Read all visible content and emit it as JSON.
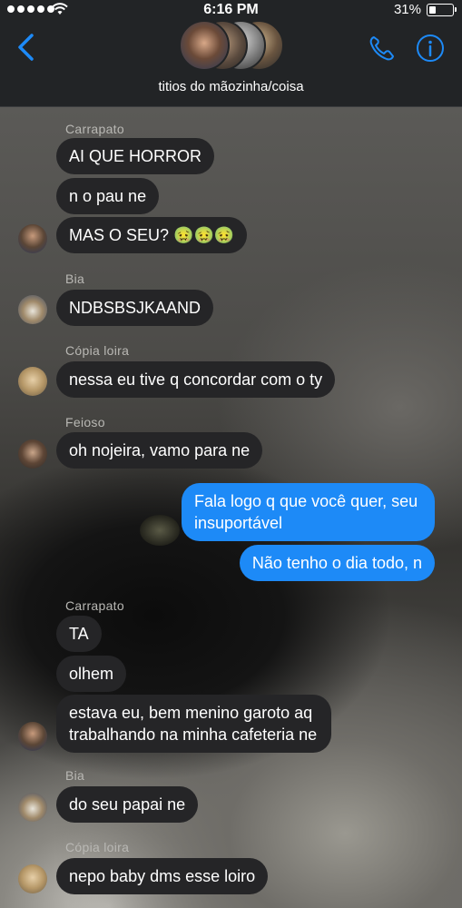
{
  "status_bar": {
    "time": "6:16 PM",
    "battery": "31%",
    "battery_level": 0.31,
    "signal_dots": 5
  },
  "header": {
    "group_name": "titios do mãozinha/coisa",
    "accent_color": "#1d8af7"
  },
  "messages": [
    {
      "type": "sender",
      "text": "Carrapato"
    },
    {
      "type": "in",
      "text": "AI QUE HORROR"
    },
    {
      "type": "in",
      "text": "n o pau ne"
    },
    {
      "type": "in",
      "text": "MAS O SEU? 🤢🤢🤢",
      "avatar": "avatar-carrapato"
    },
    {
      "type": "sender",
      "text": "Bia"
    },
    {
      "type": "in",
      "text": "NDBSBSJKAAND",
      "avatar": "avatar-bia"
    },
    {
      "type": "sender",
      "text": "Cópia loira"
    },
    {
      "type": "in",
      "text": "nessa eu tive q concordar com o ty",
      "avatar": "avatar-copia-loira"
    },
    {
      "type": "sender",
      "text": "Feioso"
    },
    {
      "type": "in",
      "text": "oh nojeira, vamo para ne",
      "avatar": "avatar-feioso"
    },
    {
      "type": "out",
      "lines": [
        "Fala logo q que você quer, seu",
        "insuportável"
      ]
    },
    {
      "type": "out",
      "text": "Não tenho o dia todo, n"
    },
    {
      "type": "sender",
      "text": "Carrapato"
    },
    {
      "type": "in",
      "text": "TA"
    },
    {
      "type": "in",
      "text": "olhem"
    },
    {
      "type": "in",
      "lines": [
        "estava eu, bem menino garoto aq",
        "trabalhando na minha cafeteria ne"
      ],
      "avatar": "avatar-carrapato"
    },
    {
      "type": "sender",
      "text": "Bia"
    },
    {
      "type": "in",
      "text": "do seu papai ne",
      "avatar": "avatar-bia"
    },
    {
      "type": "sender",
      "text": "Cópia loira"
    },
    {
      "type": "in",
      "text": "nepo baby dms esse loiro",
      "avatar": "avatar-copia-loira"
    }
  ]
}
